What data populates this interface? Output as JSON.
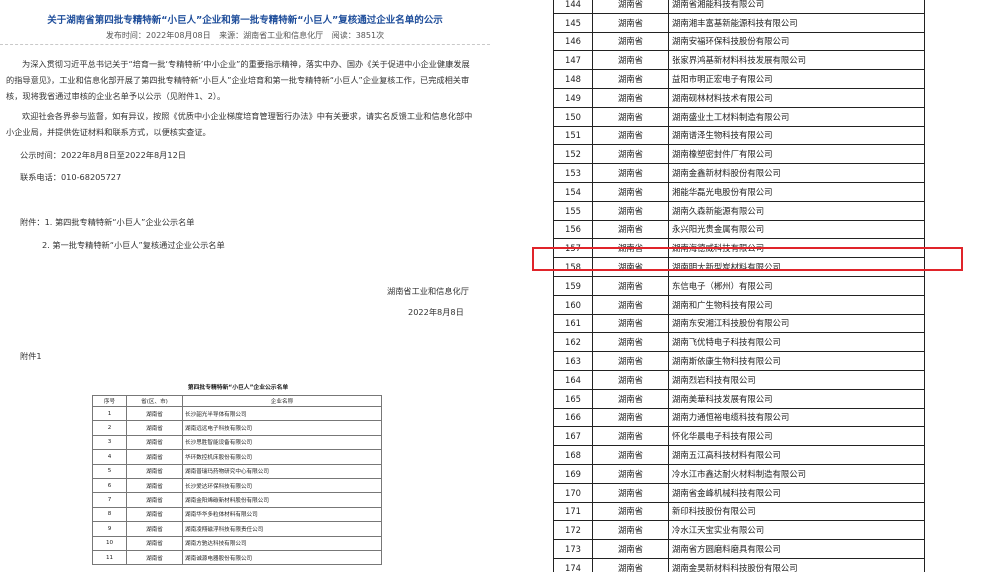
{
  "article": {
    "title": "关于湖南省第四批专精特新“小巨人”企业和第一批专精特新“小巨人”复核通过企业名单的公示",
    "publish_time": "发布时间：2022年08月08日",
    "source": "来源：湖南省工业和信息化厅",
    "views": "阅读：3851次",
    "para1": "为深入贯彻习近平总书记关于“培育一批‘专精特新’中小企业”的重要指示精神，落实中办、国办《关于促进中小企业健康发展的指导意见》，工业和信息化部开展了第四批专精特新“小巨人”企业培育和第一批专精特新“小巨人”企业复核工作，已完成相关审核，现将我省通过审核的企业名单予以公示（见附件1、2）。",
    "para2": "欢迎社会各界参与监督，如有异议，按照《优质中小企业梯度培育管理暂行办法》中有关要求，请实名反馈工业和信息化部中小企业局，并提供佐证材料和联系方式，以便核实查证。",
    "period": "公示时间：2022年8月8日至2022年8月12日",
    "phone": "联系电话：010-68205727",
    "attach1": "附件：1. 第四批专精特新“小巨人”企业公示名单",
    "attach2": "2. 第一批专精特新“小巨人”复核通过企业公示名单",
    "signer": "湖南省工业和信息化厅",
    "date": "2022年8月8日",
    "attach_label": "附件1"
  },
  "mini_table": {
    "caption": "第四批专精特新“小巨人”企业公示名单",
    "headers": [
      "序号",
      "省(区、市)",
      "企业名称"
    ],
    "rows": [
      [
        "1",
        "湖南省",
        "长沙韶光半导体有限公司"
      ],
      [
        "2",
        "湖南省",
        "湖南远远电子科技有限公司"
      ],
      [
        "3",
        "湖南省",
        "长沙思胜智能设备有限公司"
      ],
      [
        "4",
        "湖南省",
        "华环数控机床股份有限公司"
      ],
      [
        "5",
        "湖南省",
        "湖南普瑞玛药物研究中心有限公司"
      ],
      [
        "6",
        "湖南省",
        "长沙爱达环保科技有限公司"
      ],
      [
        "7",
        "湖南省",
        "湖南金阳烯碳新材料股份有限公司"
      ],
      [
        "8",
        "湖南省",
        "湖南华华多粒体材料有限公司"
      ],
      [
        "9",
        "湖南省",
        "湖南凌翔磁浮科技有限责任公司"
      ],
      [
        "10",
        "湖南省",
        "湖南方驰达科技有限公司"
      ],
      [
        "11",
        "湖南省",
        "湖南诚源电器股份有限公司"
      ]
    ]
  },
  "big_table": {
    "rows": [
      [
        "144",
        "湖南省",
        "湖南省湘能科技有限公司"
      ],
      [
        "145",
        "湖南省",
        "湖南湘丰富基新能源科技有限公司"
      ],
      [
        "146",
        "湖南省",
        "湖南安福环保科技股份有限公司"
      ],
      [
        "147",
        "湖南省",
        "张家界鸿基新材料科技发展有限公司"
      ],
      [
        "148",
        "湖南省",
        "益阳市明正宏电子有限公司"
      ],
      [
        "149",
        "湖南省",
        "湖南砚林材料技术有限公司"
      ],
      [
        "150",
        "湖南省",
        "湖南盛业土工材料制造有限公司"
      ],
      [
        "151",
        "湖南省",
        "湖南谱泽生物科技有限公司"
      ],
      [
        "152",
        "湖南省",
        "湖南橡塑密封件厂有限公司"
      ],
      [
        "153",
        "湖南省",
        "湖南金鑫新材料股份有限公司"
      ],
      [
        "154",
        "湖南省",
        "湘能华磊光电股份有限公司"
      ],
      [
        "155",
        "湖南省",
        "湖南久森新能源有限公司"
      ],
      [
        "156",
        "湖南省",
        "永兴阳光贵金属有限公司"
      ],
      [
        "157",
        "湖南省",
        "湖南海德威科技有限公司"
      ],
      [
        "158",
        "湖南省",
        "湖南明大新型炭材料有限公司"
      ],
      [
        "159",
        "湖南省",
        "东信电子（郴州）有限公司"
      ],
      [
        "160",
        "湖南省",
        "湖南和广生物科技有限公司"
      ],
      [
        "161",
        "湖南省",
        "湖南东安湘江科技股份有限公司"
      ],
      [
        "162",
        "湖南省",
        "湖南飞优特电子科技有限公司"
      ],
      [
        "163",
        "湖南省",
        "湖南斯依康生物科技有限公司"
      ],
      [
        "164",
        "湖南省",
        "湖南烈岩科技有限公司"
      ],
      [
        "165",
        "湖南省",
        "湖南美華科技发展有限公司"
      ],
      [
        "166",
        "湖南省",
        "湖南力通恒裕电缆科技有限公司"
      ],
      [
        "167",
        "湖南省",
        "怀化华晨电子科技有限公司"
      ],
      [
        "168",
        "湖南省",
        "湖南五江高科技材料有限公司"
      ],
      [
        "169",
        "湖南省",
        "冷水江市鑫达耐火材料制造有限公司"
      ],
      [
        "170",
        "湖南省",
        "湖南省金峰机械科技有限公司"
      ],
      [
        "171",
        "湖南省",
        "新印科技股份有限公司"
      ],
      [
        "172",
        "湖南省",
        "冷水江天宝实业有限公司"
      ],
      [
        "173",
        "湖南省",
        "湖南省方圆磨料磨具有限公司"
      ],
      [
        "174",
        "湖南省",
        "湖南金昊新材料科技股份有限公司"
      ]
    ]
  },
  "colors": {
    "title": "#1f4e9b",
    "highlight": "#e0242a"
  }
}
